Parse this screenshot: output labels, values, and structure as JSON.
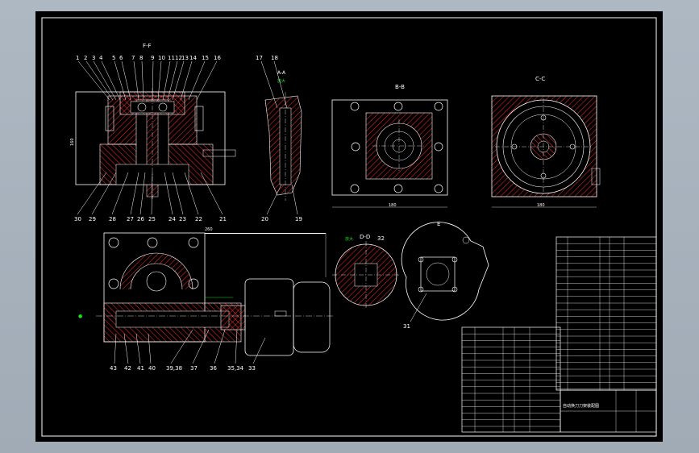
{
  "drawing": {
    "view_titles": {
      "f": "F-F",
      "a": "A-A",
      "b": "B-B",
      "c": "C-C",
      "d": "D-D",
      "e": "E"
    },
    "magnify_labels": [
      "放大",
      "放大"
    ],
    "leader_labels_top": [
      "1",
      "2",
      "3",
      "4",
      "5",
      "6",
      "7",
      "8",
      "9",
      "10",
      "11",
      "12",
      "13",
      "14",
      "15",
      "16"
    ],
    "leader_labels_ff_bottom": [
      "30",
      "29",
      "28",
      "27",
      "26",
      "25",
      "24",
      "23",
      "22",
      "21"
    ],
    "leader_labels_aa": [
      "17",
      "18",
      "20",
      "19"
    ],
    "leader_labels_bottom": [
      "43",
      "42",
      "41",
      "40",
      "39,38",
      "37",
      "36",
      "35,34",
      "33"
    ],
    "leader_labels_misc": [
      "32",
      "31"
    ],
    "dimension_labels": {
      "bb_width": "180",
      "cc_width": "180",
      "ff_height": "160",
      "main_width": "260"
    }
  },
  "title_block": {
    "name": "自动换刀刀架装配图"
  },
  "colors": {
    "sheet": "#000000",
    "frame": "#ffffff",
    "hatch": "#ff2020",
    "leader": "#ffffff",
    "note": "#22dd22"
  }
}
